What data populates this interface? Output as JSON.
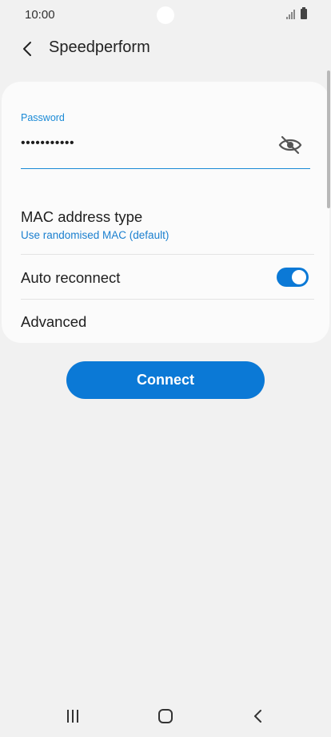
{
  "status_bar": {
    "time": "10:00",
    "icons": [
      "signal-icon",
      "battery-icon"
    ]
  },
  "header": {
    "back_icon": "chevron-left-icon",
    "title": "Speedperform"
  },
  "password": {
    "label": "Password",
    "value": "•••••••••••",
    "visibility_icon": "eye-off-icon"
  },
  "mac_address": {
    "title": "MAC address type",
    "value": "Use randomised MAC (default)"
  },
  "auto_reconnect": {
    "title": "Auto reconnect",
    "enabled": true
  },
  "advanced": {
    "title": "Advanced"
  },
  "connect_button": {
    "label": "Connect"
  },
  "nav_bar": {
    "icons": [
      "recent-apps-icon",
      "home-icon",
      "back-icon"
    ]
  },
  "colors": {
    "accent": "#0b79d6",
    "label_blue": "#1a8ad6",
    "background": "#f1f1f1",
    "card": "#fbfbfb"
  }
}
